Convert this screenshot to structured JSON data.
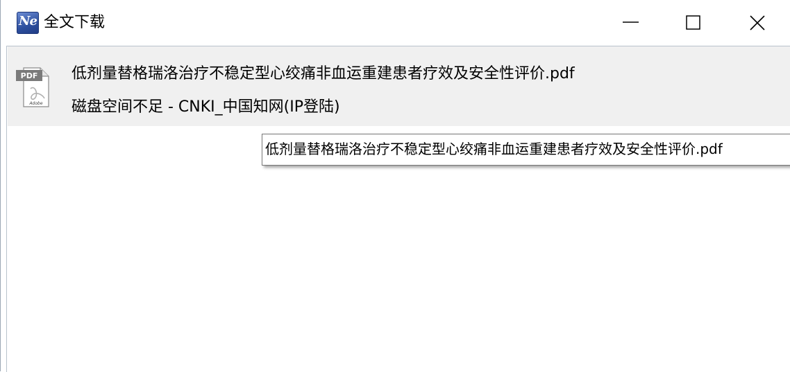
{
  "window": {
    "title": "全文下载",
    "logo_text": "Ne",
    "controls": {
      "minimize_icon": "minimize-icon",
      "maximize_icon": "maximize-icon",
      "close_icon": "close-icon"
    }
  },
  "downloads": {
    "items": [
      {
        "file_icon": "pdf-file-icon",
        "icon_label": "PDF",
        "icon_brand": "Adobe",
        "file_name": "低剂量替格瑞洛治疗不稳定型心绞痛非血运重建患者疗效及安全性评价.pdf",
        "status": "磁盘空间不足  -  CNKI_中国知网(IP登陆)"
      }
    ]
  },
  "tooltip": {
    "text": "低剂量替格瑞洛治疗不稳定型心绞痛非血运重建患者疗效及安全性评价.pdf"
  },
  "colors": {
    "selected_row_bg": "#f0f0f0",
    "logo_blue": "#2d4f9e"
  }
}
